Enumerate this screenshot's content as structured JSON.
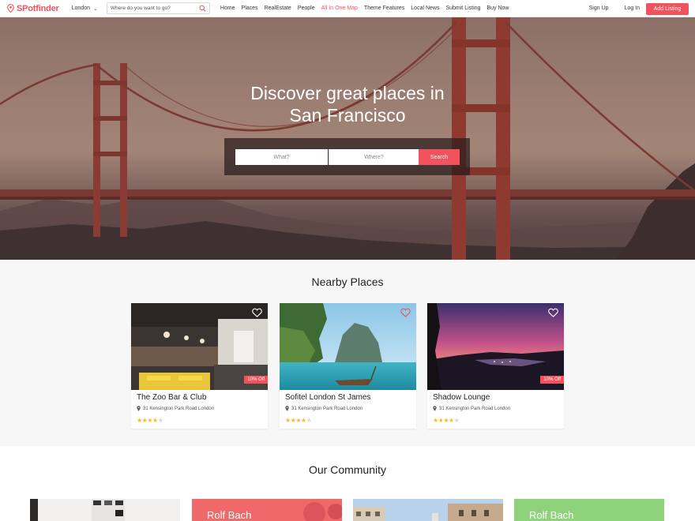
{
  "brand": {
    "logo_text": "SPotfinder",
    "accent_color": "#f0525e"
  },
  "header": {
    "city_selector": "London",
    "search_placeholder": "Where do you want to go?",
    "nav_items": [
      "Home",
      "Places",
      "RealEstate",
      "People",
      "All In One Map",
      "Theme Features",
      "Local News",
      "Submit Listing",
      "Buy Now"
    ],
    "active_nav": "All In One Map",
    "sign_up": "Sign Up",
    "log_in": "Log In",
    "add_listing": "Add Listing"
  },
  "hero": {
    "title_line1": "Discover great places in",
    "title_line2": "San Francisco",
    "what_placeholder": "What?",
    "where_placeholder": "Where?",
    "search_button": "Search"
  },
  "nearby": {
    "title": "Nearby Places",
    "places": [
      {
        "name": "The Zoo Bar & Club",
        "address": "31 Kensington Park Road London",
        "rating": 4,
        "max_rating": 5,
        "badge": "10% Off"
      },
      {
        "name": "Sofitel London St James",
        "address": "31 Kensington Park Road London",
        "rating": 4,
        "max_rating": 5,
        "badge": ""
      },
      {
        "name": "Shadow Lounge",
        "address": "31 Kensington Park Road London",
        "rating": 4,
        "max_rating": 5,
        "badge": "10% Off"
      }
    ]
  },
  "community": {
    "title": "Our Community",
    "members": [
      "",
      "Rolf Bach",
      "",
      "Rolf Bach"
    ]
  }
}
